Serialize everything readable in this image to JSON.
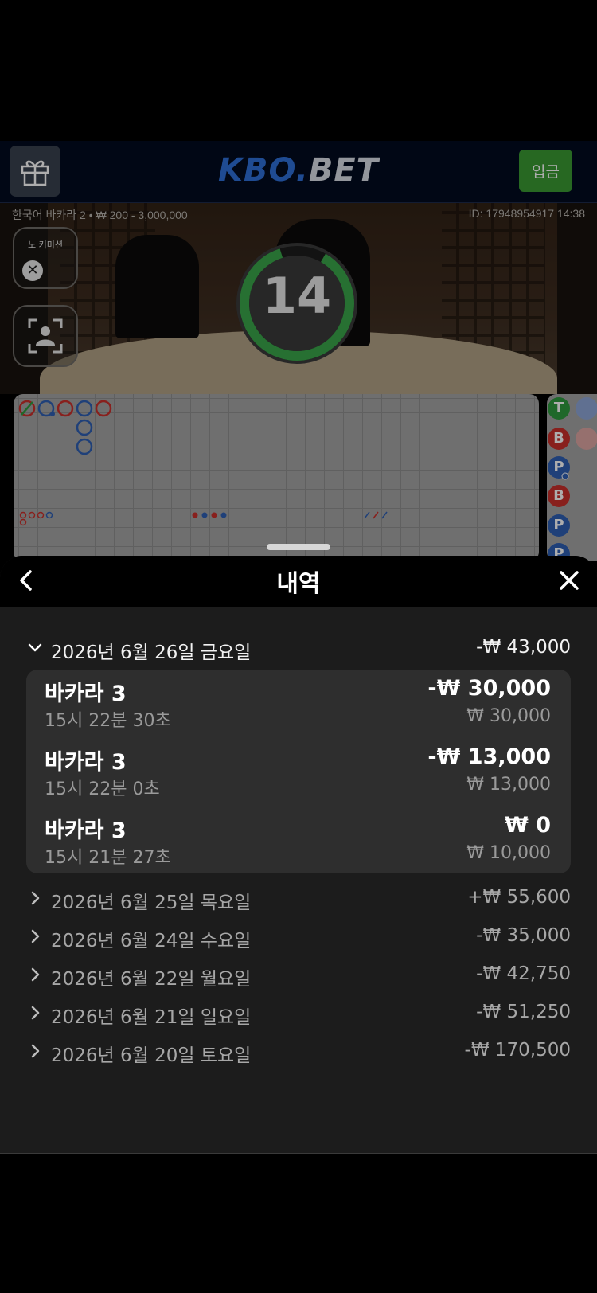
{
  "header": {
    "logo_part1": "KBO.",
    "logo_part2": "BET",
    "deposit_label": "입금"
  },
  "video": {
    "table_info": "한국어 바카라 2 • ₩ 200 - 3,000,000",
    "round_id": "ID: 17948954917 14:38",
    "no_commission_label": "노 커미션",
    "countdown": "14"
  },
  "history": {
    "title": "내역",
    "days": [
      {
        "date": "2026년 6월 26일 금요일",
        "total": "-₩ 43,000",
        "expanded": true,
        "entries": [
          {
            "game": "바카라 3",
            "time": "15시 22분 30초",
            "result": "-₩ 30,000",
            "stake": "₩ 30,000"
          },
          {
            "game": "바카라 3",
            "time": "15시 22분 0초",
            "result": "-₩ 13,000",
            "stake": "₩ 13,000"
          },
          {
            "game": "바카라 3",
            "time": "15시 21분 27초",
            "result": "₩ 0",
            "stake": "₩ 10,000"
          }
        ]
      },
      {
        "date": "2026년 6월 25일 목요일",
        "total": "+₩ 55,600",
        "expanded": false
      },
      {
        "date": "2026년 6월 24일 수요일",
        "total": "-₩ 35,000",
        "expanded": false
      },
      {
        "date": "2026년 6월 22일 월요일",
        "total": "-₩ 42,750",
        "expanded": false
      },
      {
        "date": "2026년 6월 21일 일요일",
        "total": "-₩ 51,250",
        "expanded": false
      },
      {
        "date": "2026년 6월 20일 토요일",
        "total": "-₩ 170,500",
        "expanded": false
      }
    ]
  },
  "roadmap": {
    "side_labels": [
      "T",
      "B",
      "P",
      "B",
      "P",
      "P"
    ]
  },
  "colors": {
    "banker": "#c9302c",
    "player": "#2f5fb3",
    "tie": "#2e9a3e",
    "deposit": "#3a9a33",
    "accent_blue": "#2e6fd8"
  },
  "icons": {
    "gift": "gift-icon",
    "back": "chevron-left-icon",
    "close": "close-icon",
    "collapse": "chevron-down-icon",
    "expand": "chevron-right-icon"
  }
}
